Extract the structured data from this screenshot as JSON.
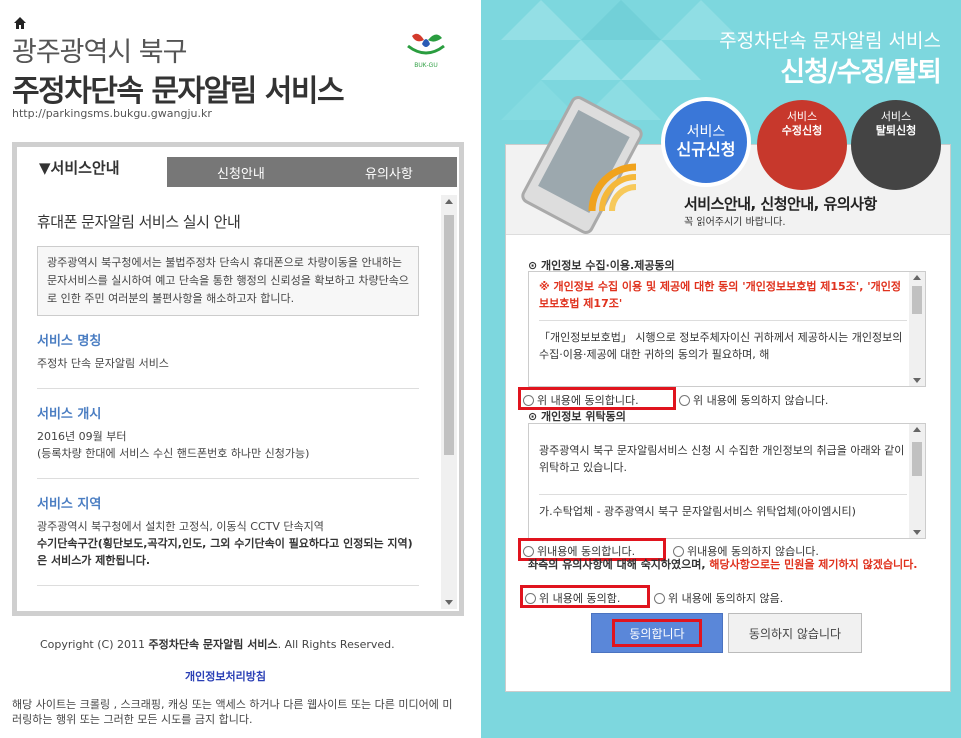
{
  "left": {
    "title_line1": "광주광역시 북구",
    "title_line2": "주정차단속 문자알림 서비스",
    "url": "http://parkingsms.bukgu.gwangju.kr",
    "logo_text": "BUK-GU",
    "tabs": {
      "active": "▼서비스안내",
      "apply": "신청안내",
      "notes": "유의사항"
    },
    "notice_title": "휴대폰 문자알림 서비스 실시 안내",
    "notice_body": "광주광역시 북구청에서는 불법주정차 단속시 휴대폰으로 차량이동을 안내하는 문자서비스를 실시하여 예고 단속을 통한 행정의 신뢰성을 확보하고 차량단속으로 인한 주민 여러분의 불편사항을 해소하고자 합니다.",
    "sections": [
      {
        "heading": "서비스 명칭",
        "text": "주정차 단속 문자알림 서비스",
        "bold": ""
      },
      {
        "heading": "서비스 개시",
        "text": "2016년 09월 부터\n(등록차량 한대에 서비스 수신 핸드폰번호 하나만 신청가능)",
        "bold": ""
      },
      {
        "heading": "서비스 지역",
        "text": "광주광역시 북구청에서 설치한 고정식, 이동식 CCTV 단속지역",
        "bold": "수기단속구간(횡단보도,곡각지,인도, 그외 수기단속이 필요하다고 인정되는 지역)은 서비스가 제한됩니다."
      }
    ],
    "copyright_prefix": "Copyright (C) 2011 ",
    "copyright_bold": "주정차단속 문자알림 서비스",
    "copyright_suffix": ". All Rights Reserved.",
    "privacy_link": "개인정보처리방침",
    "footer_note": "해당 사이트는 크롤링 , 스크래핑, 캐싱 또는 액세스 하거나 다른 웹사이트 또는 다른 미디어에 미러링하는 행위 또는 그러한 모든 시도를 금지 합니다."
  },
  "right": {
    "title_line1": "주정차단속 문자알림 서비스",
    "title_line2": "신청/수정/탈퇴",
    "circles": {
      "new_line1": "서비스",
      "new_line2": "신규신청",
      "edit_line1": "서비스",
      "edit_line2": "수정신청",
      "del_line1": "서비스",
      "del_line2": "탈퇴신청"
    },
    "card_heading": "서비스안내, 신청안내, 유의사항",
    "card_sub": "꼭 읽어주시기 바랍니다.",
    "section1_title": "⊙ 개인정보 수집·이용.제공동의",
    "box1_red": "※ 개인정보 수집 이용 및 제공에 대한 동의 '개인정보보호법 제15조', '개인정보보호법 제17조'",
    "box1_text": "「개인정보보호법」 시행으로 정보주체자이신 귀하께서 제공하시는 개인정보의 수집·이용·제공에 대한 귀하의 동의가 필요하며, 해",
    "radio1_agree": "위 내용에 동의합니다.",
    "radio1_disagree": "위 내용에 동의하지 않습니다.",
    "section2_title": "⊙ 개인정보 위탁동의",
    "box2_text": "광주광역시 북구 문자알림서비스 신청 시 수집한 개인정보의 취급을 아래와 같이 위탁하고 있습니다.",
    "box2_text2": "가.수탁업체 - 광주광역시 북구 문자알림서비스 위탁업체(아이엠시티)",
    "radio2_agree": "위내용에 동의합니다.",
    "radio2_disagree": "위내용에 동의하지 않습니다.",
    "notice_black": "좌측의 유의사항에 대해 숙지하였으며, ",
    "notice_red": "해당사항으로는 민원을 제기하지 않겠습니다.",
    "radio3_agree": "위 내용에 동의함.",
    "radio3_disagree": "위 내용에 동의하지 않음.",
    "btn_agree": "동의합니다",
    "btn_disagree": "동의하지 않습니다"
  }
}
